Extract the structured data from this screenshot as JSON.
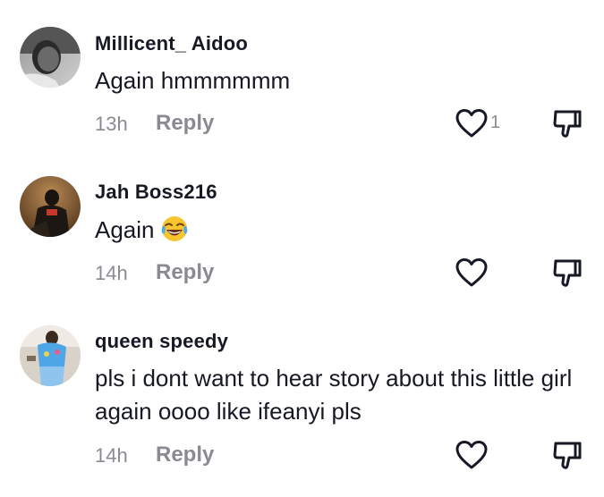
{
  "comments": [
    {
      "username": "Millicent_ Aidoo",
      "text": "Again hmmmmmm",
      "time": "13h",
      "reply_label": "Reply",
      "like_count": "1"
    },
    {
      "username": "Jah Boss216",
      "text": "Again",
      "emoji": "face-with-tears-of-joy",
      "time": "14h",
      "reply_label": "Reply",
      "like_count": ""
    },
    {
      "username": "queen speedy",
      "text": "pls i dont want to hear story about this little girl again oooo like ifeanyi pls",
      "time": "14h",
      "reply_label": "Reply",
      "like_count": ""
    }
  ],
  "colors": {
    "text_primary": "#161823",
    "text_secondary": "#8a8b91",
    "icon": "#161823"
  }
}
